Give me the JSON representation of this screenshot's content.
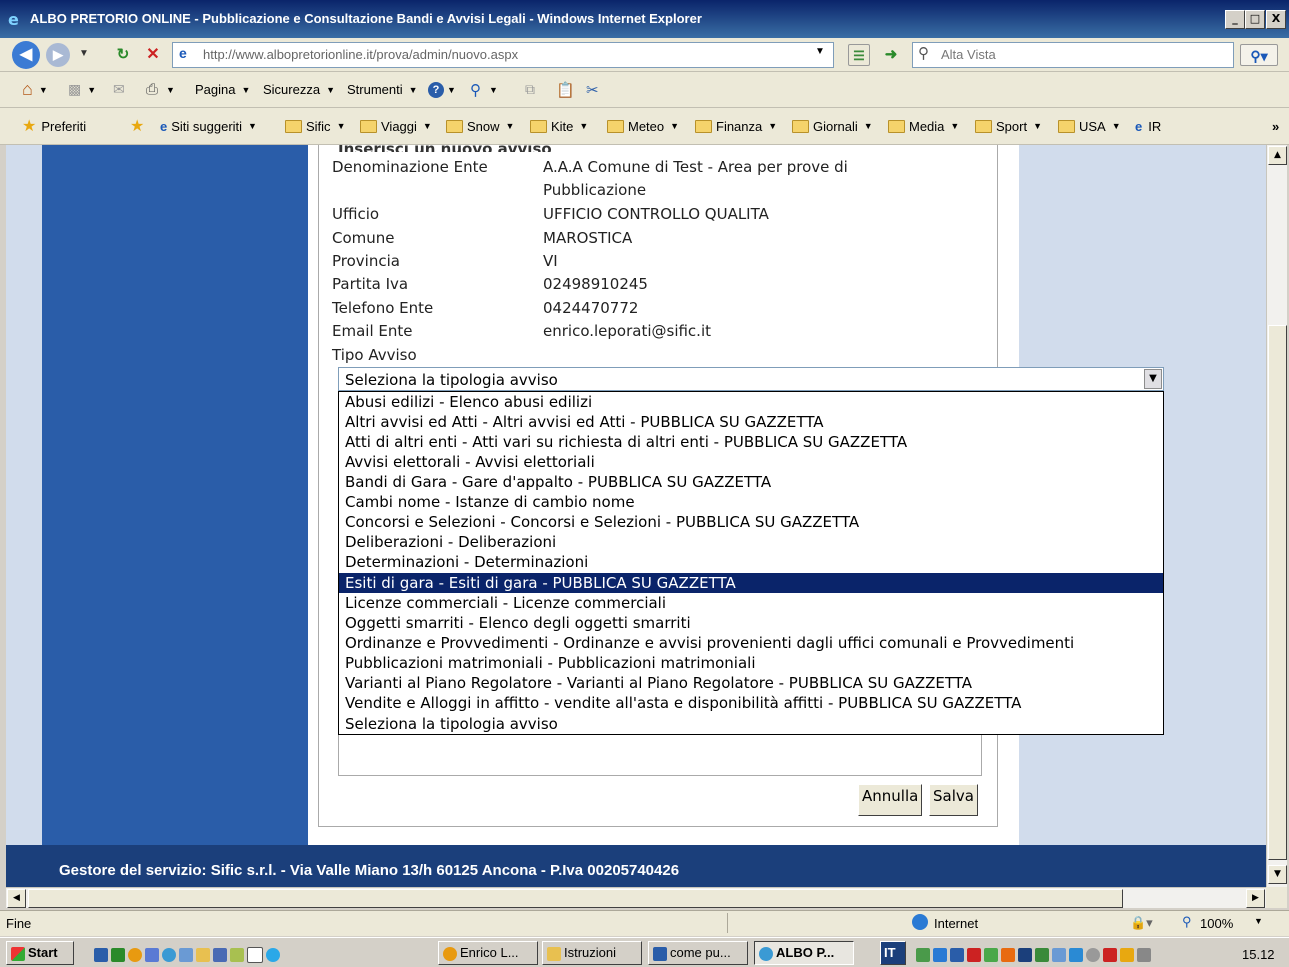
{
  "window": {
    "title": "ALBO PRETORIO ONLINE - Pubblicazione e Consultazione Bandi e Avvisi Legali - Windows Internet Explorer",
    "min_label": "_",
    "max_label": "□",
    "close_label": "X"
  },
  "navbar": {
    "url": "http://www.albopretorionline.it/prova/admin/nuovo.aspx",
    "search_placeholder": "Alta Vista"
  },
  "commandbar": {
    "items": [
      "Pagina",
      "Sicurezza",
      "Strumenti"
    ]
  },
  "favbar": {
    "favorites_label": "Preferiti",
    "suggested_label": "Siti suggeriti",
    "folders": [
      "Sific",
      "Viaggi",
      "Snow",
      "Kite",
      "Meteo",
      "Finanza",
      "Giornali",
      "Media",
      "Sport",
      "USA"
    ],
    "last_label": "IR",
    "chevron": "»"
  },
  "form": {
    "heading_partial": "Inserisci un nuovo avviso",
    "fields": [
      {
        "label": "Denominazione Ente",
        "value": "A.A.A Comune di Test - Area per prove di",
        "value2": "Pubblicazione"
      },
      {
        "label": "Ufficio",
        "value": "UFFICIO CONTROLLO QUALITA"
      },
      {
        "label": "Comune",
        "value": "MAROSTICA"
      },
      {
        "label": "Provincia",
        "value": "VI"
      },
      {
        "label": "Partita Iva",
        "value": "02498910245"
      },
      {
        "label": "Telefono Ente",
        "value": "0424470772"
      },
      {
        "label": "Email Ente",
        "value": "enrico.leporati@sific.it"
      }
    ],
    "tipo_label": "Tipo Avviso",
    "select_value": "Seleziona la tipologia avviso",
    "options": [
      "Abusi edilizi - Elenco abusi edilizi",
      "Altri avvisi ed Atti - Altri avvisi ed Atti - PUBBLICA SU GAZZETTA",
      "Atti di altri enti - Atti vari su richiesta di altri enti - PUBBLICA SU GAZZETTA",
      "Avvisi elettorali - Avvisi elettoriali",
      "Bandi di Gara - Gare d'appalto - PUBBLICA SU GAZZETTA",
      "Cambi nome - Istanze di cambio nome",
      "Concorsi e Selezioni - Concorsi e Selezioni - PUBBLICA SU GAZZETTA",
      "Deliberazioni - Deliberazioni",
      "Determinazioni - Determinazioni",
      "Esiti di gara - Esiti di gara - PUBBLICA SU GAZZETTA",
      "Licenze commerciali - Licenze commerciali",
      "Oggetti smarriti - Elenco degli oggetti smarriti",
      "Ordinanze e Provvedimenti - Ordinanze e avvisi provenienti dagli uffici comunali e Provvedimenti",
      "Pubblicazioni matrimoniali - Pubblicazioni matrimoniali",
      "Varianti al Piano Regolatore - Varianti al Piano Regolatore - PUBBLICA SU GAZZETTA",
      "Vendite e Alloggi in affitto - vendite all'asta e disponibilità affitti - PUBBLICA SU GAZZETTA",
      "Seleziona la tipologia avviso"
    ],
    "highlighted_option": "Esiti di gara - Esiti di gara - PUBBLICA SU GAZZETTA",
    "cancel_label": "Annulla",
    "save_label": "Salva"
  },
  "footer": {
    "text": "Gestore del servizio: Sific s.r.l. - Via Valle Miano 13/h 60125 Ancona - P.Iva 00205740426"
  },
  "statusbar": {
    "status": "Fine",
    "zone": "Internet",
    "zoom": "100%"
  },
  "taskbar": {
    "start_label": "Start",
    "tasks": [
      "Enrico L...",
      "Istruzioni",
      "come pu...",
      "ALBO P..."
    ],
    "lang": "IT",
    "clock": "15.12"
  },
  "colors": {
    "sidebar_blue": "#2a5da9",
    "footer_blue": "#1b3f7b",
    "highlight": "#0a246a"
  }
}
